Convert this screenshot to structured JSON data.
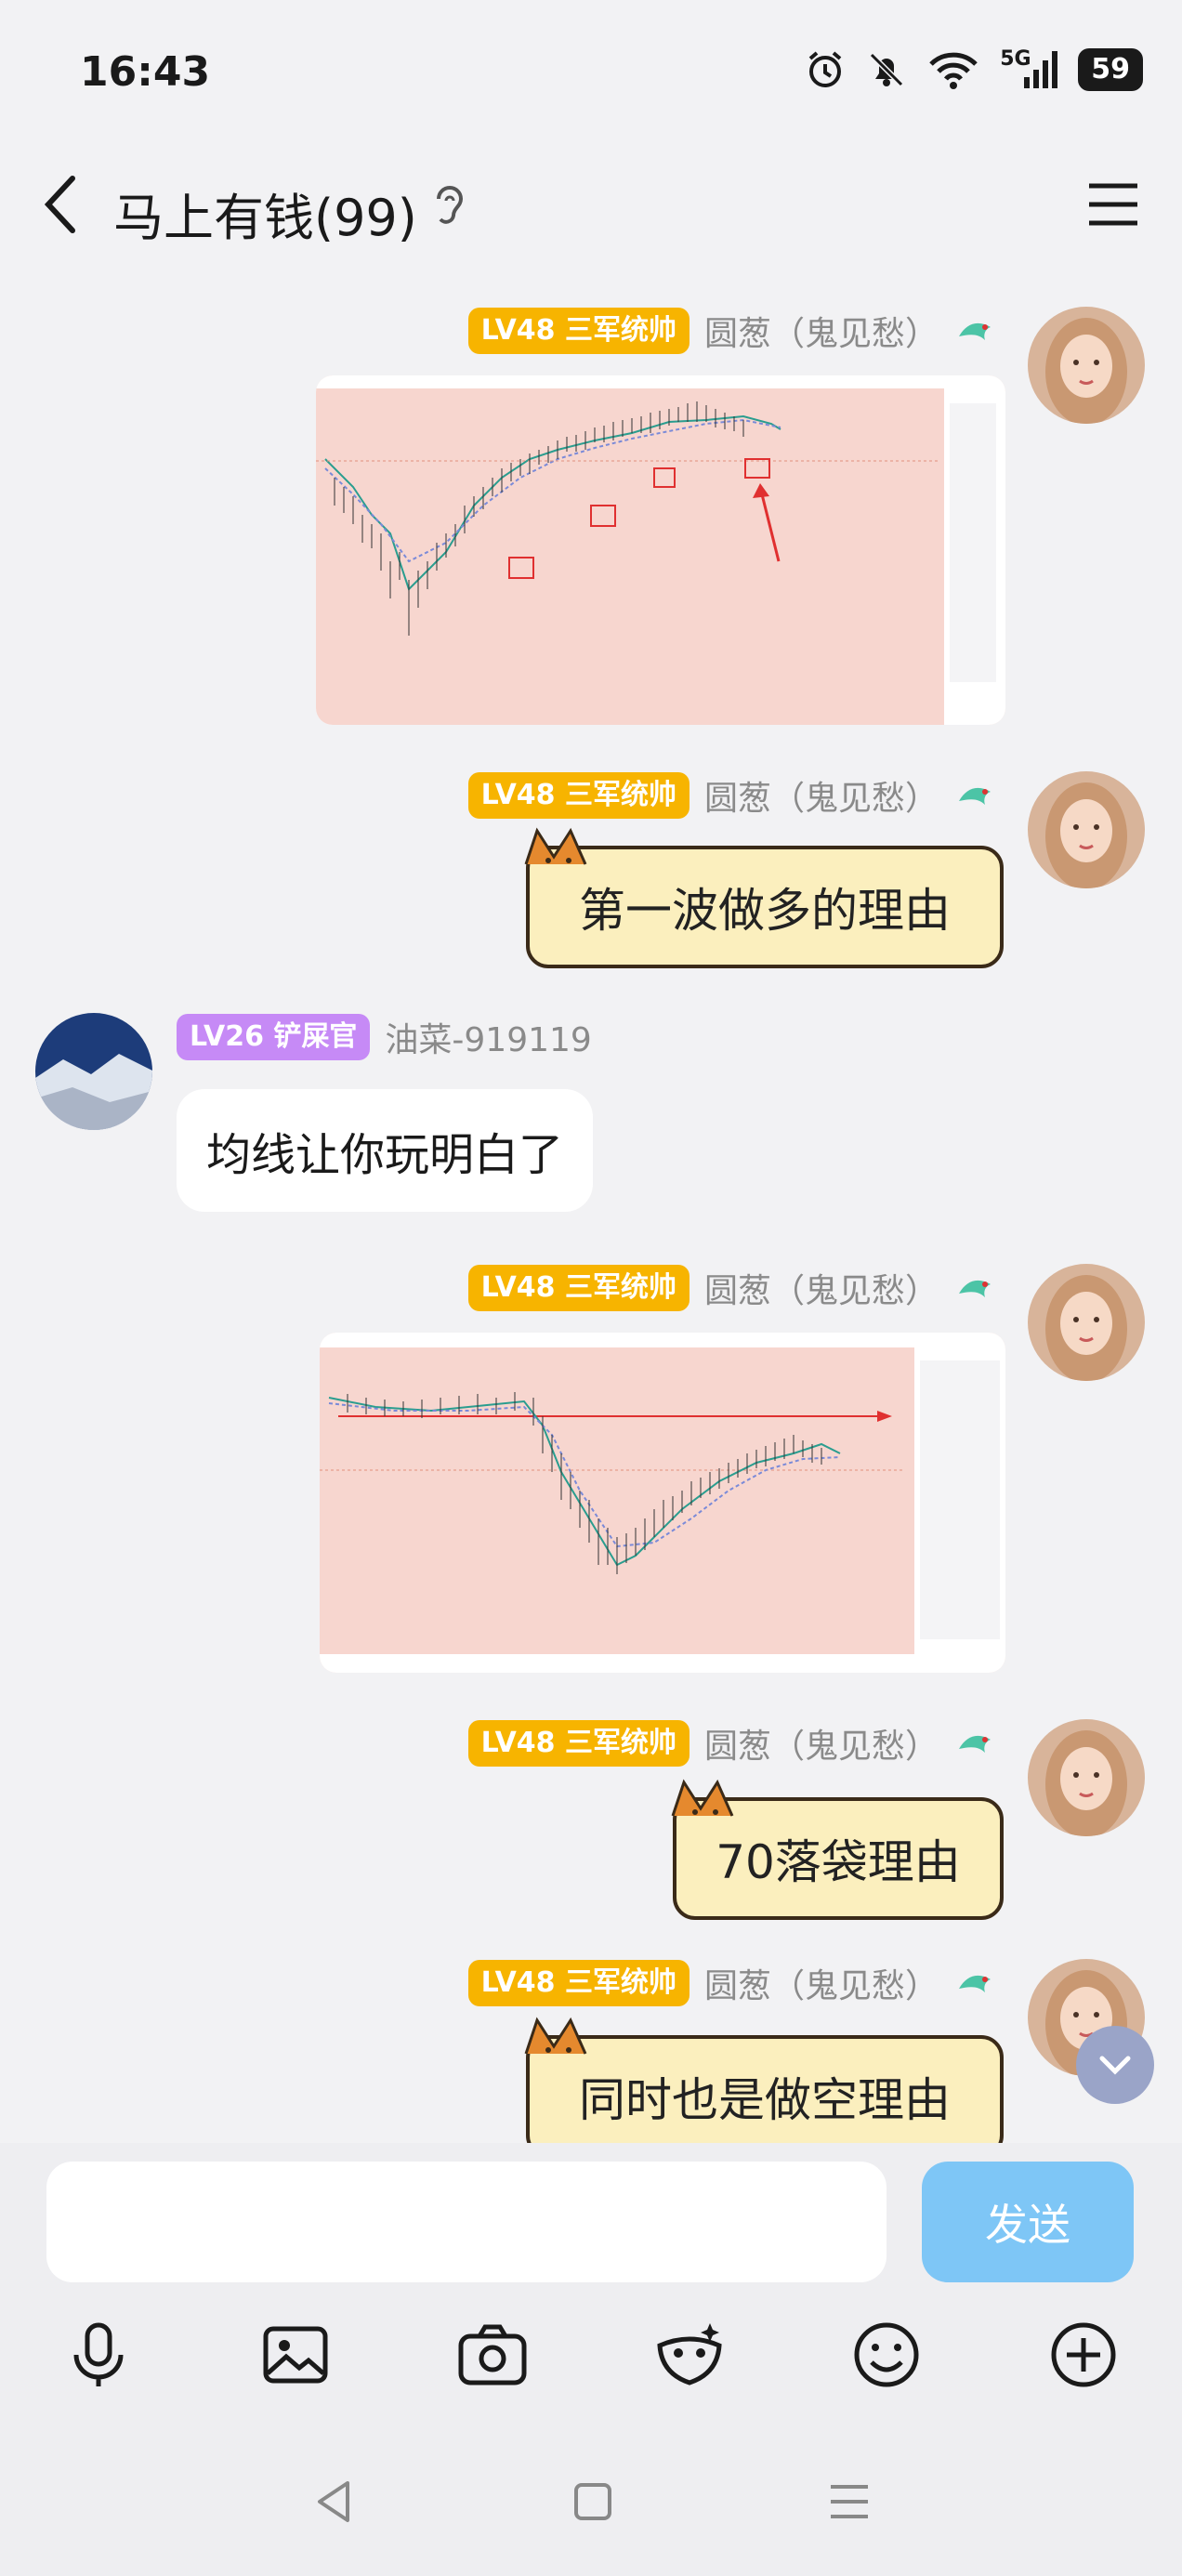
{
  "status": {
    "time": "16:43",
    "network": "5G",
    "battery": "59"
  },
  "header": {
    "title": "马上有钱(99)"
  },
  "messages": [
    {
      "side": "right",
      "level": "LV48 三军统帅",
      "nick": "圆葱（鬼见愁）",
      "type": "image"
    },
    {
      "side": "right",
      "level": "LV48 三军统帅",
      "nick": "圆葱（鬼见愁）",
      "type": "text",
      "text": "第一波做多的理由"
    },
    {
      "side": "left",
      "level": "LV26 铲屎官",
      "nick": "油菜-919119",
      "type": "text",
      "text": "均线让你玩明白了"
    },
    {
      "side": "right",
      "level": "LV48 三军统帅",
      "nick": "圆葱（鬼见愁）",
      "type": "image"
    },
    {
      "side": "right",
      "level": "LV48 三军统帅",
      "nick": "圆葱（鬼见愁）",
      "type": "text",
      "text": "70落袋理由"
    },
    {
      "side": "right",
      "level": "LV48 三军统帅",
      "nick": "圆葱（鬼见愁）",
      "type": "text",
      "text": "同时也是做空理由"
    }
  ],
  "input": {
    "placeholder": "",
    "send_label": "发送"
  },
  "toolbar": [
    "mic-icon",
    "image-icon",
    "camera-icon",
    "mask-icon",
    "emoji-icon",
    "plus-icon"
  ],
  "colors": {
    "level48": "#f7b400",
    "level26": "#c68af6",
    "send": "#7ec6f6",
    "bubble": "#fbefbe"
  }
}
